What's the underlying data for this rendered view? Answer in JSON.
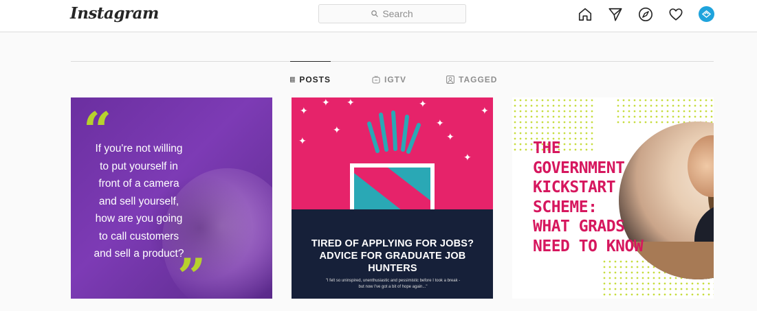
{
  "header": {
    "logo": "Instagram",
    "search_placeholder": "Search",
    "nav_icons": [
      "home-icon",
      "direct-icon",
      "explore-icon",
      "activity-icon",
      "profile-avatar"
    ]
  },
  "tabs": [
    {
      "label": "POSTS",
      "icon": "grid-icon",
      "active": true
    },
    {
      "label": "IGTV",
      "icon": "igtv-icon",
      "active": false
    },
    {
      "label": "TAGGED",
      "icon": "tagged-icon",
      "active": false
    }
  ],
  "posts": [
    {
      "quote_lines": [
        "If you're not willing",
        "to put yourself in",
        "front of a camera",
        "and sell yourself,",
        "how are you going",
        "to call customers",
        "and sell a product?"
      ],
      "quote_open": "“",
      "quote_close": "”"
    },
    {
      "title_lines": [
        "TIRED OF APPLYING FOR JOBS?",
        "ADVICE FOR GRADUATE JOB",
        "HUNTERS"
      ],
      "quote_lines": [
        "\"I felt so uninspired, unenthusiastic and pessimistic before I took a break -",
        "but now I've got a bit of hope again...\""
      ]
    },
    {
      "title_lines": [
        "THE",
        "GOVERNMENT",
        "KICKSTART",
        "SCHEME:",
        "WHAT GRADS",
        "NEED TO KNOW"
      ]
    }
  ],
  "colors": {
    "accent_blue": "#1fa3dc",
    "post1_purple": "#6b2fa0",
    "quote_green": "#b7d12d",
    "post2_pink": "#e6236a",
    "post2_navy": "#162039",
    "post3_pink": "#d6175e"
  }
}
